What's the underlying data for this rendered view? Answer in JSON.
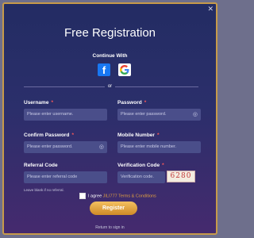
{
  "title": "Free Registration",
  "continue_with": "Continue With",
  "social": {
    "facebook_icon": "facebook-icon",
    "google_icon": "google-icon"
  },
  "or_text": "or",
  "fields": {
    "username": {
      "label": "Username",
      "placeholder": "Please enter username."
    },
    "password": {
      "label": "Password",
      "placeholder": "Please enter password."
    },
    "confirm_password": {
      "label": "Confirm Password",
      "placeholder": "Please enter password."
    },
    "mobile": {
      "label": "Mobile Number",
      "placeholder": "Please enter mobile number."
    },
    "referral": {
      "label": "Referral Code",
      "placeholder": "Please enter referral code"
    },
    "verification": {
      "label": "Verification Code",
      "placeholder": "Verification code."
    }
  },
  "required_mark": "*",
  "referral_hint": "Leave blank if no referral.",
  "captcha_text": "6280",
  "agree": {
    "prefix": "I agree",
    "terms": "JILI777 Terms & Conditions"
  },
  "register_label": "Register",
  "signin_text": "Return to sign in",
  "close_text": "✕",
  "colors": {
    "accent": "#e0a040",
    "background": "#2b2f6b",
    "required": "#ff5a5a"
  }
}
